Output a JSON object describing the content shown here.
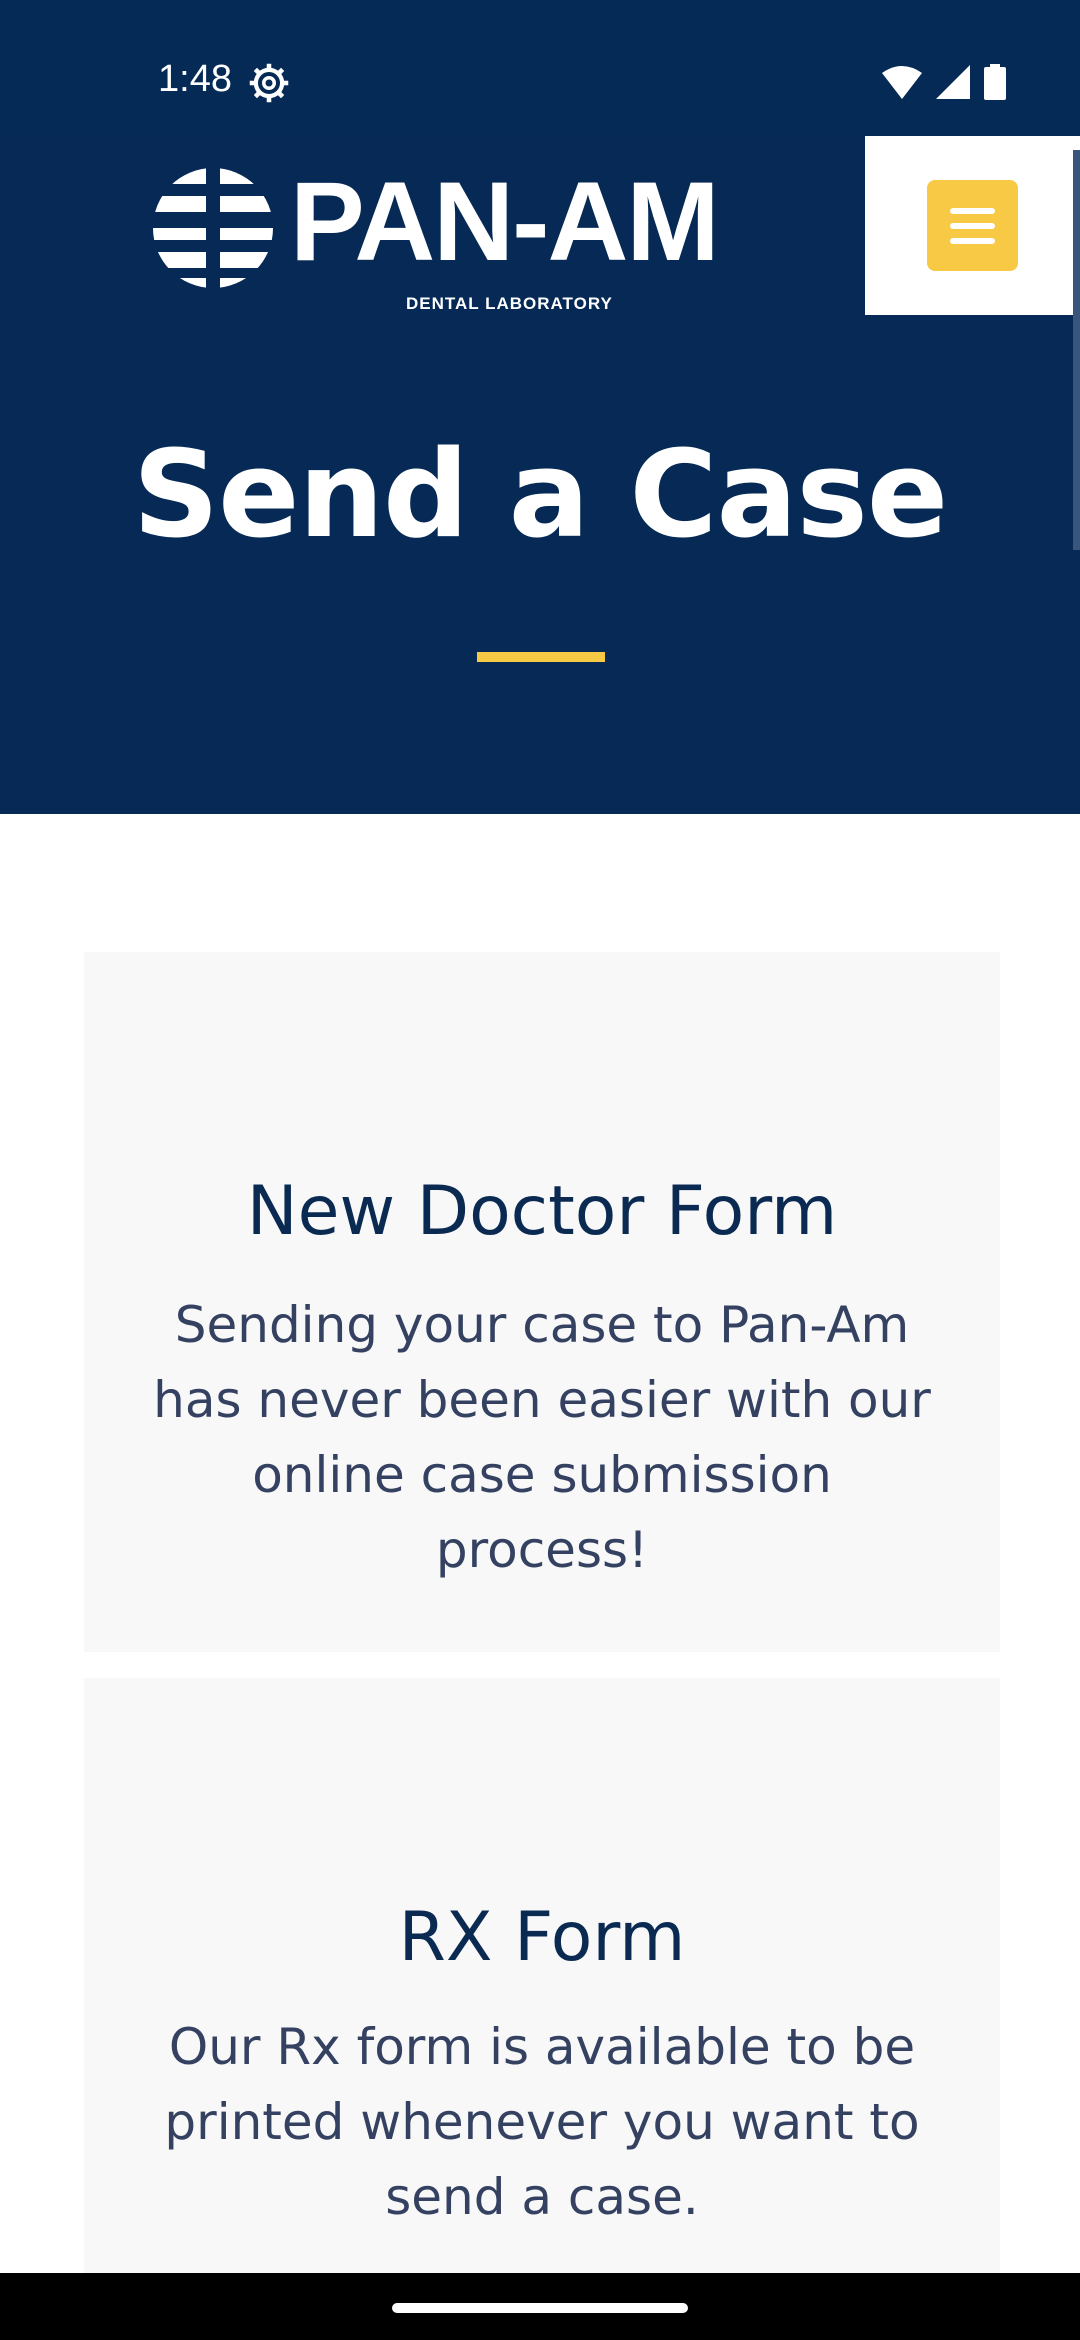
{
  "status_bar": {
    "time": "1:48",
    "icons": [
      "settings-gear-icon",
      "wifi-icon",
      "cell-signal-icon",
      "battery-icon"
    ]
  },
  "header": {
    "logo_word": "PAN-AM",
    "logo_sub": "DENTAL LABORATORY",
    "menu_icon": "hamburger-menu-icon"
  },
  "hero": {
    "title": "Send a Case"
  },
  "cards": [
    {
      "title": "New Doctor Form",
      "text": "Sending your case to Pan-Am has never been easier with our online case submission process!"
    },
    {
      "title": "RX Form",
      "text": "Our Rx form is available to be printed whenever you want to send a case."
    }
  ],
  "colors": {
    "navy": "#062a55",
    "accent_yellow": "#f7c945",
    "card_bg": "#f8f8f9",
    "card_title": "#0b2a52",
    "card_text": "#344160"
  }
}
